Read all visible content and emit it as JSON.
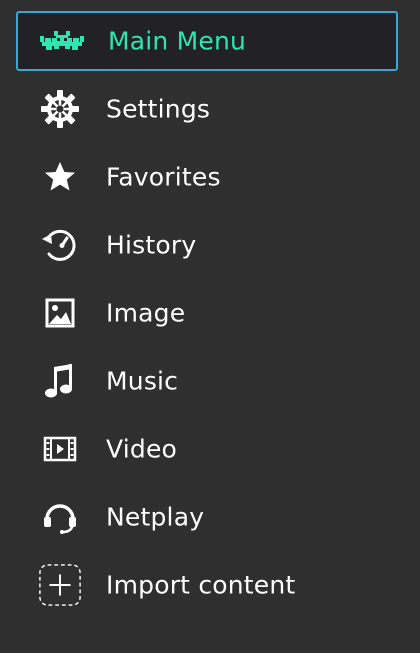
{
  "colors": {
    "background": "#2f2f2f",
    "selected_background": "#212126",
    "selected_border": "#36a6d6",
    "accent": "#2ee6b2",
    "text": "#ffffff"
  },
  "menu": {
    "items": [
      {
        "label": "Main Menu",
        "icon": "retroarch-invader-icon",
        "selected": true
      },
      {
        "label": "Settings",
        "icon": "gear-icon",
        "selected": false
      },
      {
        "label": "Favorites",
        "icon": "star-icon",
        "selected": false
      },
      {
        "label": "History",
        "icon": "history-icon",
        "selected": false
      },
      {
        "label": "Image",
        "icon": "image-icon",
        "selected": false
      },
      {
        "label": "Music",
        "icon": "music-note-icon",
        "selected": false
      },
      {
        "label": "Video",
        "icon": "film-icon",
        "selected": false
      },
      {
        "label": "Netplay",
        "icon": "headset-icon",
        "selected": false
      },
      {
        "label": "Import content",
        "icon": "add-content-icon",
        "selected": false
      }
    ]
  }
}
